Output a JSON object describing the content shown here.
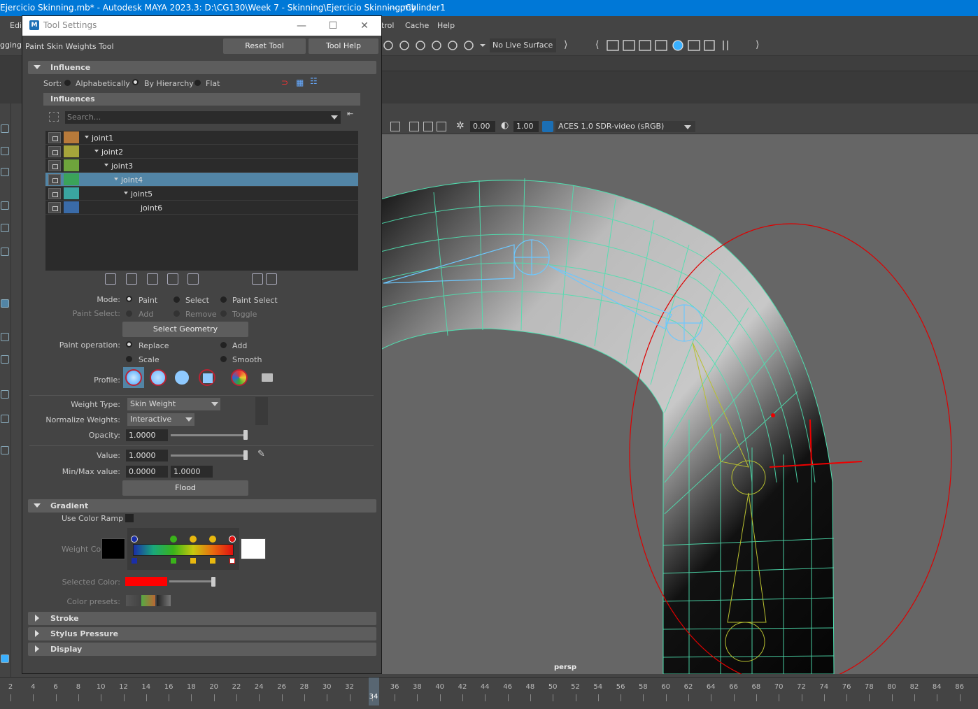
{
  "window": {
    "title": "Ejercicio Skinning.mb* - Autodesk MAYA 2023.3: D:\\CG130\\Week 7 - Skinning\\Ejercicio Skinning.mb",
    "selected_object": "---   pCylinder1"
  },
  "menu": {
    "items": [
      "Edi",
      "trol",
      "Cache",
      "Help"
    ],
    "left_fragment": "gging"
  },
  "status_line": {
    "live_surface": "No Live Surface"
  },
  "panel_toolbar": {
    "exposure": "0.00",
    "gamma": "1.00",
    "color_space": "ACES 1.0 SDR-video (sRGB)"
  },
  "viewport": {
    "camera": "persp"
  },
  "timeline": {
    "ticks": [
      "2",
      "4",
      "6",
      "8",
      "10",
      "12",
      "14",
      "16",
      "18",
      "20",
      "22",
      "24",
      "26",
      "28",
      "30",
      "32",
      "34",
      "36",
      "38",
      "40",
      "42",
      "44",
      "46",
      "48",
      "50",
      "52",
      "54",
      "56",
      "58",
      "60",
      "62",
      "64",
      "66",
      "68",
      "70",
      "72",
      "74",
      "76",
      "78",
      "80",
      "82",
      "84",
      "86"
    ],
    "current_frame": "34"
  },
  "tool_settings": {
    "title": "Tool Settings",
    "tool_name": "Paint Skin Weights Tool",
    "reset_tool": "Reset Tool",
    "tool_help": "Tool Help",
    "influence": {
      "header": "Influence",
      "sort_label": "Sort:",
      "sort_options": [
        "Alphabetically",
        "By Hierarchy",
        "Flat"
      ],
      "sort_selected": "By Hierarchy",
      "influences_header": "Influences",
      "search_placeholder": "Search...",
      "joints": [
        {
          "name": "joint1",
          "color": "#b87a3a",
          "depth": 0,
          "selected": false
        },
        {
          "name": "joint2",
          "color": "#a6a53b",
          "depth": 1,
          "selected": false
        },
        {
          "name": "joint3",
          "color": "#6ea43c",
          "depth": 2,
          "selected": false
        },
        {
          "name": "joint4",
          "color": "#3ba35a",
          "depth": 3,
          "selected": true
        },
        {
          "name": "joint5",
          "color": "#3aa5a1",
          "depth": 4,
          "selected": false
        },
        {
          "name": "joint6",
          "color": "#3a6ba8",
          "depth": 5,
          "selected": false
        }
      ]
    },
    "mode": {
      "label": "Mode:",
      "options": [
        "Paint",
        "Select",
        "Paint Select"
      ],
      "selected": "Paint"
    },
    "paint_select": {
      "label": "Paint Select:",
      "options": [
        "Add",
        "Remove",
        "Toggle"
      ]
    },
    "select_geometry": "Select Geometry",
    "paint_operation": {
      "label": "Paint operation:",
      "options": [
        "Replace",
        "Add",
        "Scale",
        "Smooth"
      ],
      "selected": "Replace"
    },
    "profile_label": "Profile:",
    "weight_type": {
      "label": "Weight Type:",
      "value": "Skin Weight"
    },
    "normalize_weights": {
      "label": "Normalize Weights:",
      "value": "Interactive"
    },
    "opacity": {
      "label": "Opacity:",
      "value": "1.0000",
      "fraction": 1.0
    },
    "value": {
      "label": "Value:",
      "value": "1.0000",
      "fraction": 1.0
    },
    "min_max": {
      "label": "Min/Max value:",
      "min": "0.0000",
      "max": "1.0000"
    },
    "flood": "Flood",
    "gradient": {
      "header": "Gradient",
      "use_color_ramp": "Use Color Ramp",
      "weight_color_label": "Weight Color:",
      "selected_color_label": "Selected Color:",
      "selected_color": "#ff0000",
      "color_presets_label": "Color presets:"
    },
    "collapsed_sections": [
      "Stroke",
      "Stylus Pressure",
      "Display"
    ]
  }
}
